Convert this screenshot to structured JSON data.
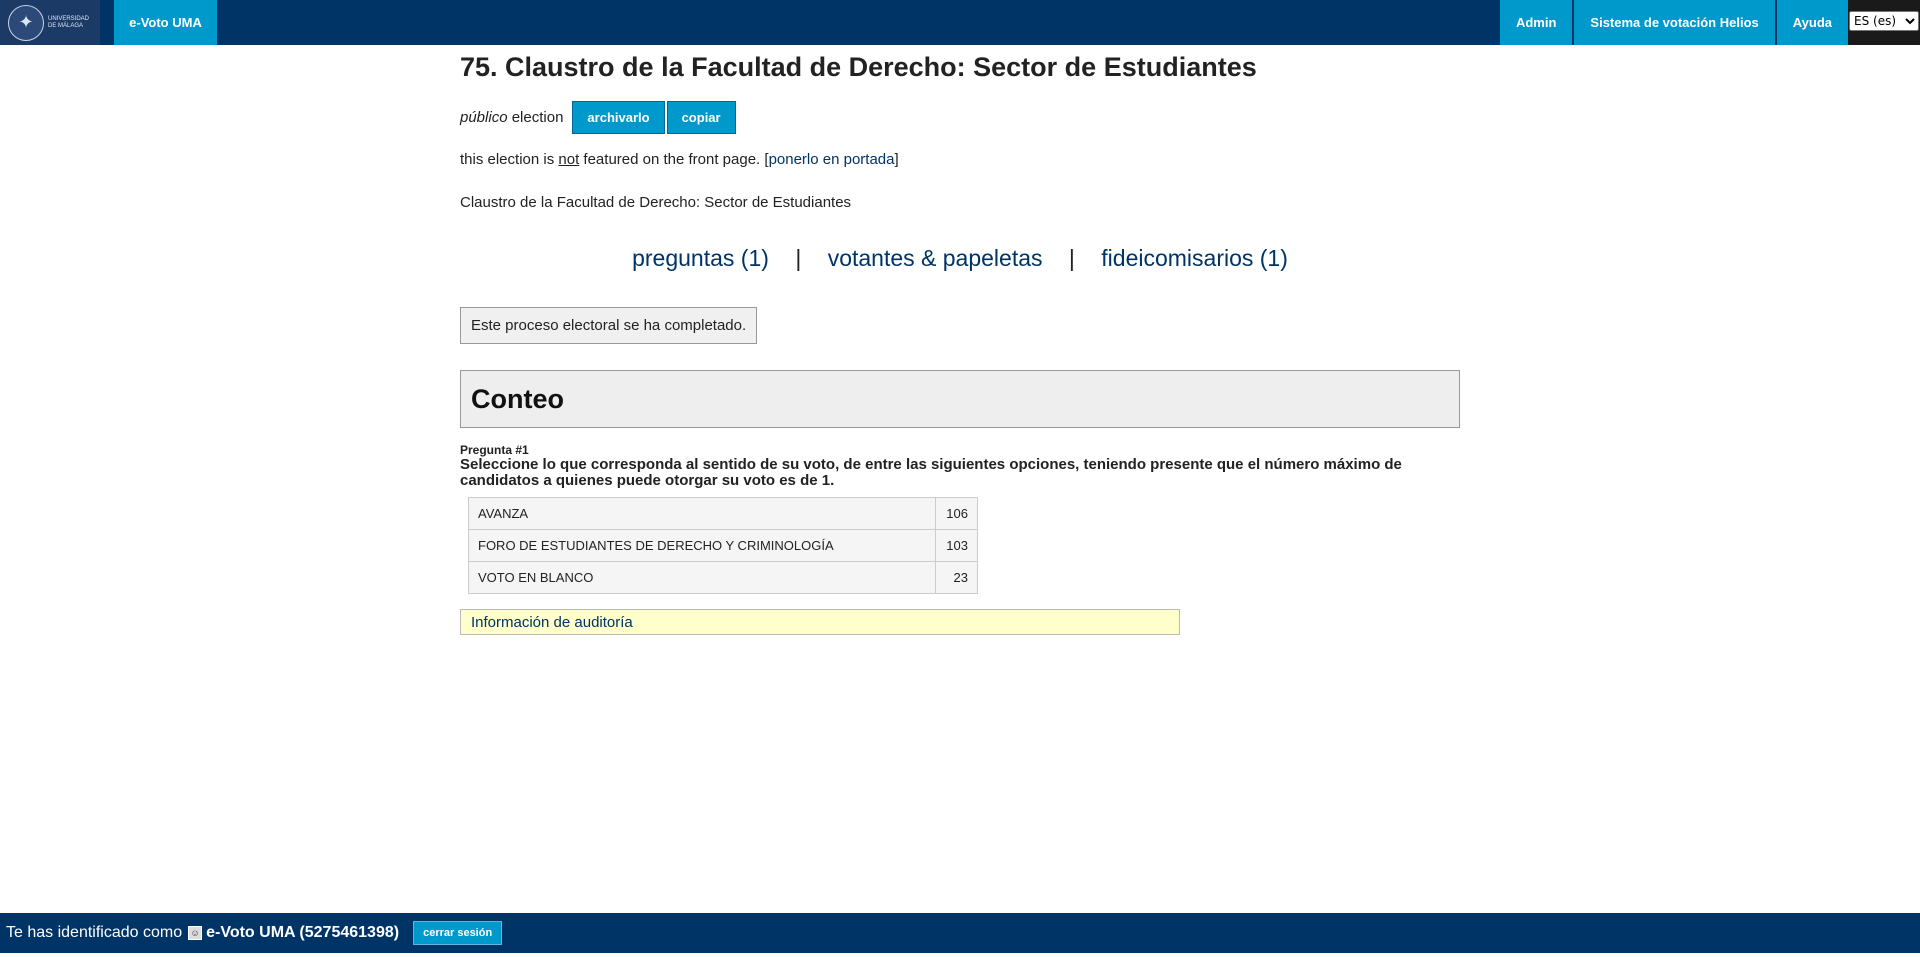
{
  "header": {
    "logo_alt": "UNIVERSIDAD DE MÁLAGA",
    "brand": "e-Voto UMA",
    "nav": [
      "Admin",
      "Sistema de votación Helios",
      "Ayuda"
    ],
    "language": "ES (es)"
  },
  "election": {
    "title": "75. Claustro de la Facultad de Derecho: Sector de Estudiantes",
    "privacy": "público",
    "privacy_suffix": "election",
    "archive_button": "archivarlo",
    "copy_button": "copiar",
    "featured_prefix": "this election is",
    "featured_not": "not",
    "featured_suffix": "featured on the front page. [",
    "featured_link": "ponerlo en portada",
    "featured_close": "]",
    "description": "Claustro de la Facultad de Derecho: Sector de Estudiantes"
  },
  "tabs": {
    "questions": "preguntas (1)",
    "voters": "votantes & papeletas",
    "trustees": "fideicomisarios (1)",
    "separator": "|"
  },
  "notice": "Este proceso electoral se ha completado.",
  "tally": {
    "heading": "Conteo",
    "question_number": "Pregunta #1",
    "question_text": "Seleccione lo que corresponda al sentido de su voto, de entre las siguientes opciones, teniendo presente que el número máximo de candidatos a quienes puede otorgar su voto es de 1.",
    "results": [
      {
        "option": "AVANZA",
        "votes": "106"
      },
      {
        "option": "FORO DE ESTUDIANTES DE DERECHO Y CRIMINOLOGÍA",
        "votes": "103"
      },
      {
        "option": "VOTO EN BLANCO",
        "votes": "23"
      }
    ]
  },
  "audit_link": "Información de auditoría",
  "footer": {
    "prefix": "Te has identificado como",
    "user": "e-Voto UMA (5275461398)",
    "logout": "cerrar sesión"
  },
  "colors": {
    "navy": "#003366",
    "accent": "#0099cc"
  }
}
